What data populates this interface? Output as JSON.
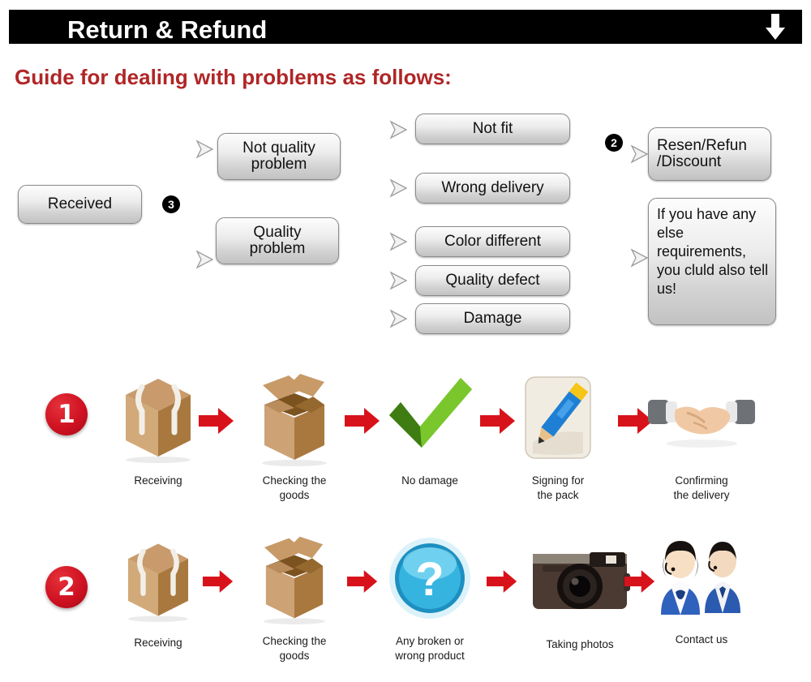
{
  "header": {
    "title": "Return & Refund",
    "arrow_icon": "arrow-down-icon",
    "bar_color": "#000000"
  },
  "guide_heading": "Guide for dealing with problems as follows:",
  "guide_color": "#B02626",
  "flowchart": {
    "nodes": {
      "received": "Received",
      "not_quality_problem": "Not quality\nproblem",
      "quality_problem": "Quality\nproblem",
      "not_fit": "Not fit",
      "wrong_delivery": "Wrong delivery",
      "color_different": "Color different",
      "quality_defect": "Quality defect",
      "damage": "Damage",
      "resend_refund": "Resen/Refun\n/Discount",
      "more_requirements": "If you have any else requirements, you cluld also tell us!"
    },
    "badges": {
      "split_badge": "3",
      "outcome_badge": "2"
    }
  },
  "process_rows": [
    {
      "number": "1",
      "steps": [
        {
          "icon": "sealed-box-icon",
          "label": "Receiving"
        },
        {
          "icon": "open-box-icon",
          "label": "Checking the\ngoods"
        },
        {
          "icon": "green-check-icon",
          "label": "No damage"
        },
        {
          "icon": "pencil-sign-icon",
          "label": "Signing for\nthe pack"
        },
        {
          "icon": "handshake-icon",
          "label": "Confirming\nthe delivery"
        }
      ]
    },
    {
      "number": "2",
      "steps": [
        {
          "icon": "sealed-box-icon",
          "label": "Receiving"
        },
        {
          "icon": "open-box-icon",
          "label": "Checking the\ngoods"
        },
        {
          "icon": "blue-question-icon",
          "label": "Any broken or\nwrong product"
        },
        {
          "icon": "camera-icon",
          "label": "Taking photos"
        },
        {
          "icon": "support-agents-icon",
          "label": "Contact us"
        }
      ]
    }
  ],
  "arrow_color": "#D8121B"
}
